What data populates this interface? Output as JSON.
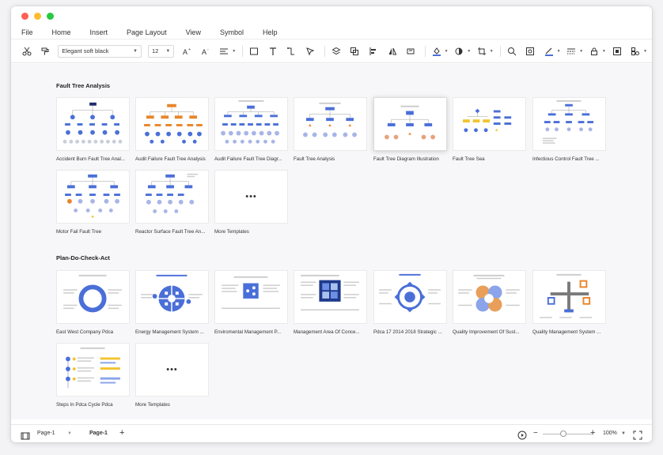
{
  "menu": [
    "File",
    "Home",
    "Insert",
    "Page Layout",
    "View",
    "Symbol",
    "Help"
  ],
  "toolbar": {
    "font_name": "Elegant soft black",
    "font_size": "12"
  },
  "sections": [
    {
      "title": "Fault Tree Analysis",
      "items": [
        "Accident Burn Fault Tree Anal...",
        "Audit Failure Fault Tree Analysis",
        "Audit Failure Fault Tree Diagr...",
        "Fault Tree Analysis",
        "Fault Tree Diagram Illustration",
        "Fault Tree Sea",
        "Infectious Control Fault Tree ...",
        "Motor Fail Fault Tree",
        "Reactor Surface Fault Tree An...",
        "More Templates"
      ]
    },
    {
      "title": "Plan-Do-Check-Act",
      "items": [
        "East West Company Pdca",
        "Energy Management System ...",
        "Enviromental Management P...",
        "Management Area Of Conce...",
        "Pdca 17 2014 2018 Strategic ...",
        "Quality Improvement Of Sust...",
        "Quality Management System ...",
        "Steps In Pdca  Cycle Pdca",
        "More Templates"
      ]
    }
  ],
  "statusbar": {
    "page_dropdown": "Page-1",
    "page_tab": "Page-1",
    "zoom": "100%"
  },
  "colors": {
    "accent_blue": "#4a6fd8",
    "accent_orange": "#e8852a",
    "window_bg": "#ffffff",
    "content_bg": "#f7f7f9"
  }
}
